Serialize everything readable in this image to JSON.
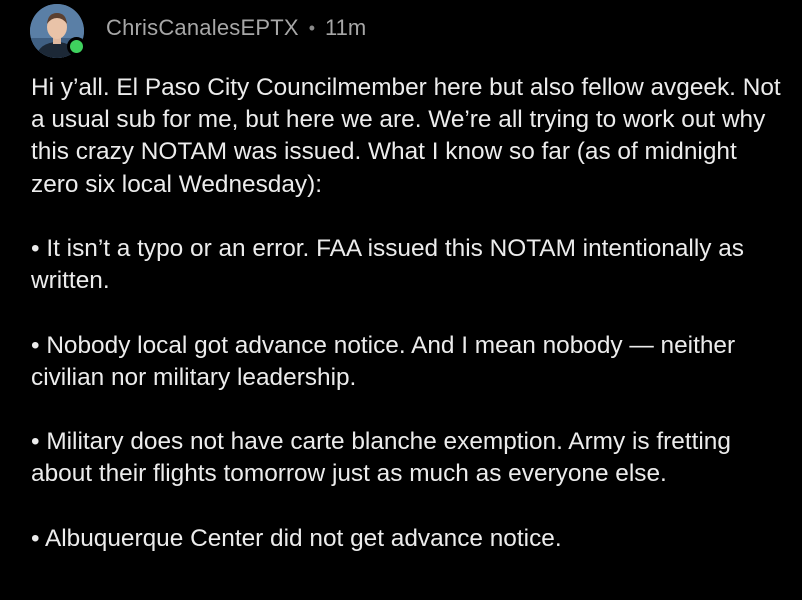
{
  "comment": {
    "author": "ChrisCanalesEPTX",
    "separator": "•",
    "timestamp": "11m",
    "avatar_icon": "avatar-icon",
    "online_status_color": "#3fd15e",
    "paragraphs": [
      "Hi y’all. El Paso City Councilmember here but also fellow avgeek. Not a usual sub for me, but here we are. We’re all trying to work out why this crazy NOTAM was issued. What I know so far (as of midnight zero six local Wednesday):",
      "• It isn’t a typo or an error. FAA issued this NOTAM intentionally as written.",
      "• Nobody local got advance notice. And I mean nobody — neither civilian nor military leadership.",
      "• Military does not have carte blanche exemption. Army is fretting about their flights tomorrow just as much as everyone else.",
      "• Albuquerque Center did not get advance notice."
    ]
  }
}
